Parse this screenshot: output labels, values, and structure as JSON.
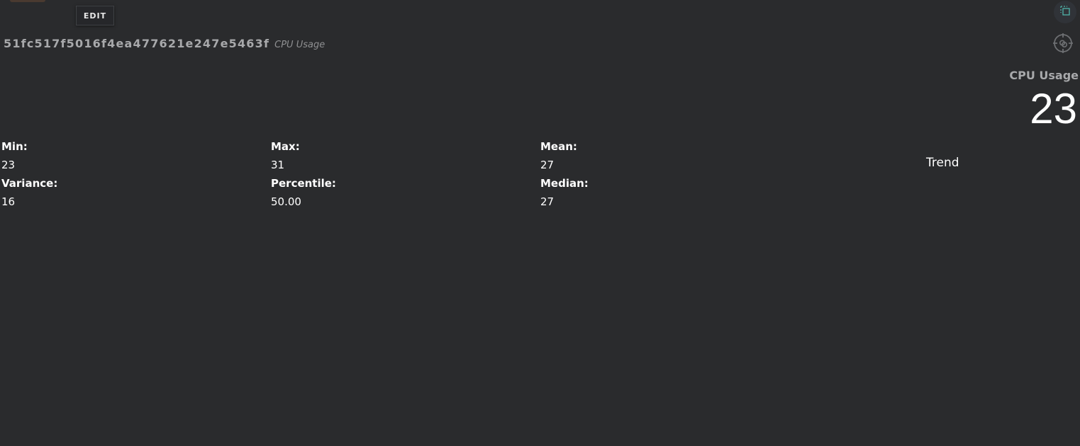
{
  "toolbar": {
    "edit_label": "EDIT"
  },
  "header": {
    "entity_id": "51fc517f5016f4ea477621e247e5463f",
    "metric_name": "CPU Usage"
  },
  "icons": {
    "copy": "copy-icon",
    "target": "target-icon"
  },
  "current": {
    "label": "CPU Usage",
    "value": "23"
  },
  "stats": {
    "min_label": "Min:",
    "min_value": "23",
    "max_label": "Max:",
    "max_value": "31",
    "mean_label": "Mean:",
    "mean_value": "27",
    "variance_label": "Variance:",
    "variance_value": "16",
    "percentile_label": "Percentile:",
    "percentile_value": "50.00",
    "median_label": "Median:",
    "median_value": "27"
  },
  "trend": {
    "label": "Trend"
  },
  "colors": {
    "background": "#2a2b2d",
    "muted_text": "#a8a9ab",
    "icon_accent": "#4fb3a9"
  }
}
